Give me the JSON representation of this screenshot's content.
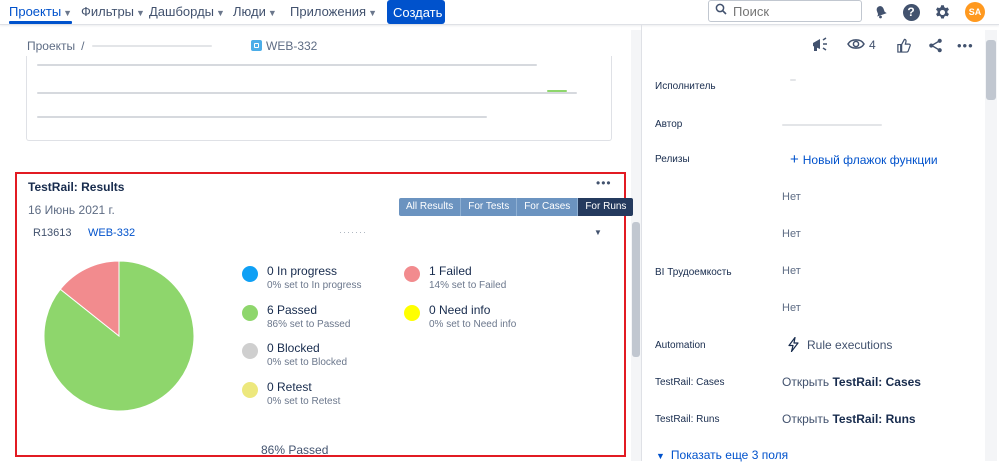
{
  "nav": {
    "items": [
      {
        "label": "Проекты",
        "active": true
      },
      {
        "label": "Фильтры",
        "active": false
      },
      {
        "label": "Дашборды",
        "active": false
      },
      {
        "label": "Люди",
        "active": false
      },
      {
        "label": "Приложения",
        "active": false
      }
    ],
    "create_label": "Создать",
    "search_placeholder": "Поиск",
    "avatar_initials": "SA",
    "avatar_color": "#ff991f"
  },
  "breadcrumb": {
    "root": "Проекты",
    "issue_key": "WEB-332"
  },
  "testrail": {
    "title": "TestRail: Results",
    "date": "16 Июнь 2021 г.",
    "tabs": [
      "All Results",
      "For Tests",
      "For Cases",
      "For Runs"
    ],
    "active_tab": "For Runs",
    "run_id": "R13613",
    "run_issue": "WEB-332",
    "legend": [
      {
        "name": "In progress",
        "count": "0",
        "label": "0 In progress",
        "sub": "0% set to In progress",
        "color": "#0fa0f5"
      },
      {
        "name": "Failed",
        "count": "1",
        "label": "1 Failed",
        "sub": "14% set to Failed",
        "color": "#f28b8e"
      },
      {
        "name": "Passed",
        "count": "6",
        "label": "6 Passed",
        "sub": "86% set to Passed",
        "color": "#8ed66c"
      },
      {
        "name": "Need info",
        "count": "0",
        "label": "0 Need info",
        "sub": "0% set to Need info",
        "color": "#ffff00"
      },
      {
        "name": "Blocked",
        "count": "0",
        "label": "0 Blocked",
        "sub": "0% set to Blocked",
        "color": "#cfcfcf"
      },
      {
        "name": "Retest",
        "count": "0",
        "label": "0 Retest",
        "sub": "0% set to Retest",
        "color": "#ede87d"
      }
    ],
    "footer_percent": "86%",
    "footer_label": "Passed"
  },
  "chart_data": {
    "type": "pie",
    "slices": [
      {
        "name": "Passed",
        "value": 6,
        "color": "#8ed66c"
      },
      {
        "name": "Failed",
        "value": 1,
        "color": "#f28b8e"
      }
    ]
  },
  "toolbar": {
    "watchers": "4"
  },
  "fields": [
    {
      "label": "Исполнитель",
      "value": ""
    },
    {
      "label": "Автор",
      "value": ""
    },
    {
      "label": "Релизы",
      "value": "Новый флажок функции"
    },
    {
      "label": "",
      "value": "Нет"
    },
    {
      "label": "",
      "value": "Нет"
    },
    {
      "label": "BI Трудоемкость",
      "value": "Нет"
    },
    {
      "label": "",
      "value": "Нет"
    },
    {
      "label": "Automation",
      "value": "Rule executions"
    },
    {
      "label": "TestRail: Cases",
      "value_prefix": "Открыть",
      "value": "TestRail: Cases"
    },
    {
      "label": "TestRail: Runs",
      "value_prefix": "Открыть",
      "value": "TestRail: Runs"
    }
  ],
  "show_more": "Показать еще 3 поля"
}
